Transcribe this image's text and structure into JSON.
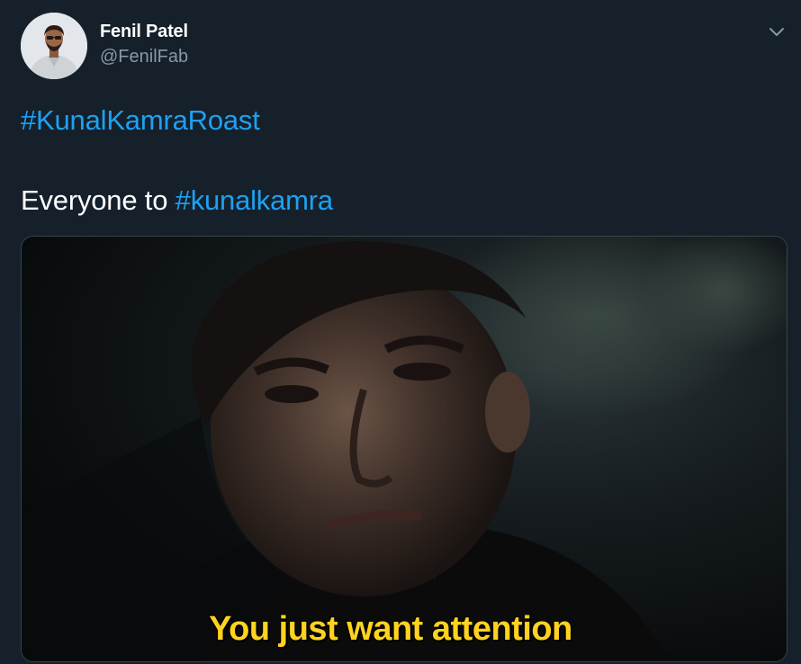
{
  "author": {
    "display_name": "Fenil Patel",
    "handle": "@FenilFab"
  },
  "icons": {
    "caret": "chevron-down-icon"
  },
  "tweet": {
    "hashtag_line": "#KunalKamraRoast",
    "text_prefix": "Everyone to ",
    "text_hashtag": "#kunalkamra"
  },
  "media": {
    "subtitle": "You just want attention"
  },
  "colors": {
    "background": "#15202b",
    "link": "#1da1f2",
    "secondary_text": "#8899a6",
    "subtitle": "#ffd21f"
  }
}
